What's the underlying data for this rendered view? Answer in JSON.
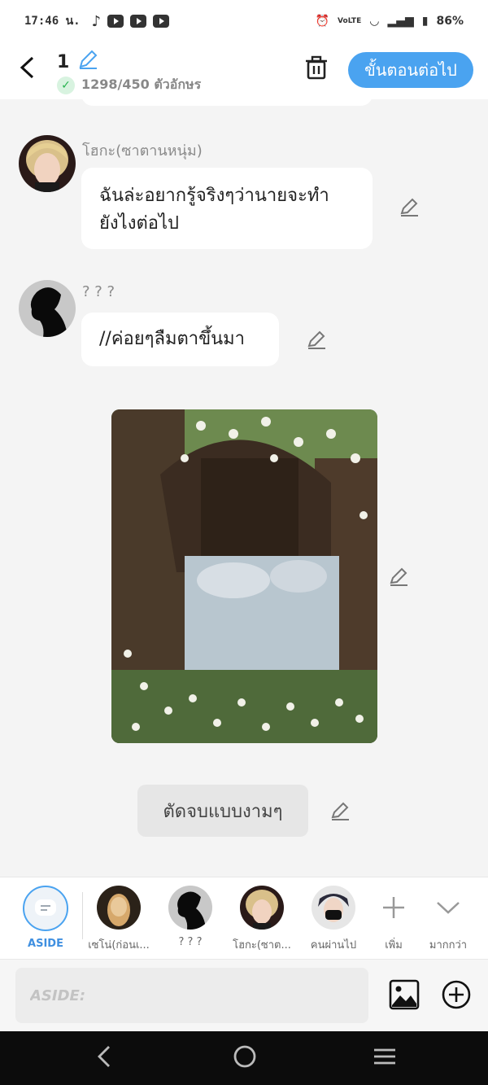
{
  "status": {
    "time": "17:46 น.",
    "battery": "86%",
    "network": "VoLTE",
    "app_icons": [
      "tiktok-icon",
      "youtube-icon",
      "youtube-icon",
      "youtube-icon"
    ]
  },
  "header": {
    "title": "1",
    "char_count": "1298/450 ตัวอักษร",
    "next_label": "ขั้นตอนต่อไป",
    "accent": "#4aa3f0"
  },
  "messages": [
    {
      "speaker": "โฮกะ(ซาตานหนุ่ม)",
      "text_line1": "ฉันล่ะอยากรู้จริงๆว่านายจะทำ",
      "text_line2": "ยังไงต่อไป"
    },
    {
      "speaker": "? ? ?",
      "text": "//ค่อยๆลืมตาขึ้นมา"
    }
  ],
  "image_message": {
    "description": "tree-bed-photo"
  },
  "aside_message": {
    "text": "ตัดจบแบบงามๆ"
  },
  "characters": [
    {
      "label": "ASIDE"
    },
    {
      "label": "เซโน่(ก่อนเ..."
    },
    {
      "label": "? ? ?"
    },
    {
      "label": "โฮกะ(ซาต..."
    },
    {
      "label": "คนผ่านไป"
    },
    {
      "label": "เพิ่ม"
    },
    {
      "label": "มากกว่า"
    }
  ],
  "input": {
    "placeholder": "ASIDE:"
  }
}
